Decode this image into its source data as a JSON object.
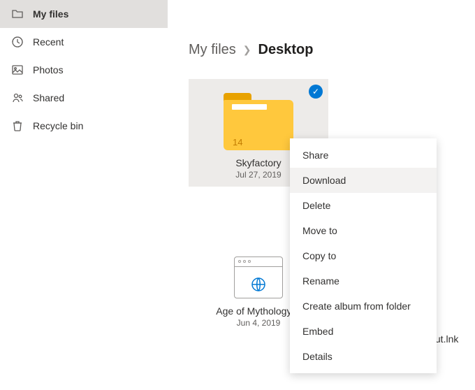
{
  "sidebar": {
    "items": [
      {
        "label": "My files",
        "icon": "folder-icon",
        "active": true
      },
      {
        "label": "Recent",
        "icon": "recent-icon",
        "active": false
      },
      {
        "label": "Photos",
        "icon": "photos-icon",
        "active": false
      },
      {
        "label": "Shared",
        "icon": "shared-icon",
        "active": false
      },
      {
        "label": "Recycle bin",
        "icon": "recycle-icon",
        "active": false
      }
    ]
  },
  "breadcrumb": {
    "root": "My files",
    "current": "Desktop"
  },
  "items": [
    {
      "name": "Skyfactory",
      "date": "Jul 27, 2019",
      "count": "14",
      "selected": true
    },
    {
      "name": "Age of Mythology E",
      "date": "Jun 4, 2019",
      "truncated_right": "tcut.lnk"
    }
  ],
  "context_menu": [
    "Share",
    "Download",
    "Delete",
    "Move to",
    "Copy to",
    "Rename",
    "Create album from folder",
    "Embed",
    "Details"
  ],
  "context_hover_index": 1
}
